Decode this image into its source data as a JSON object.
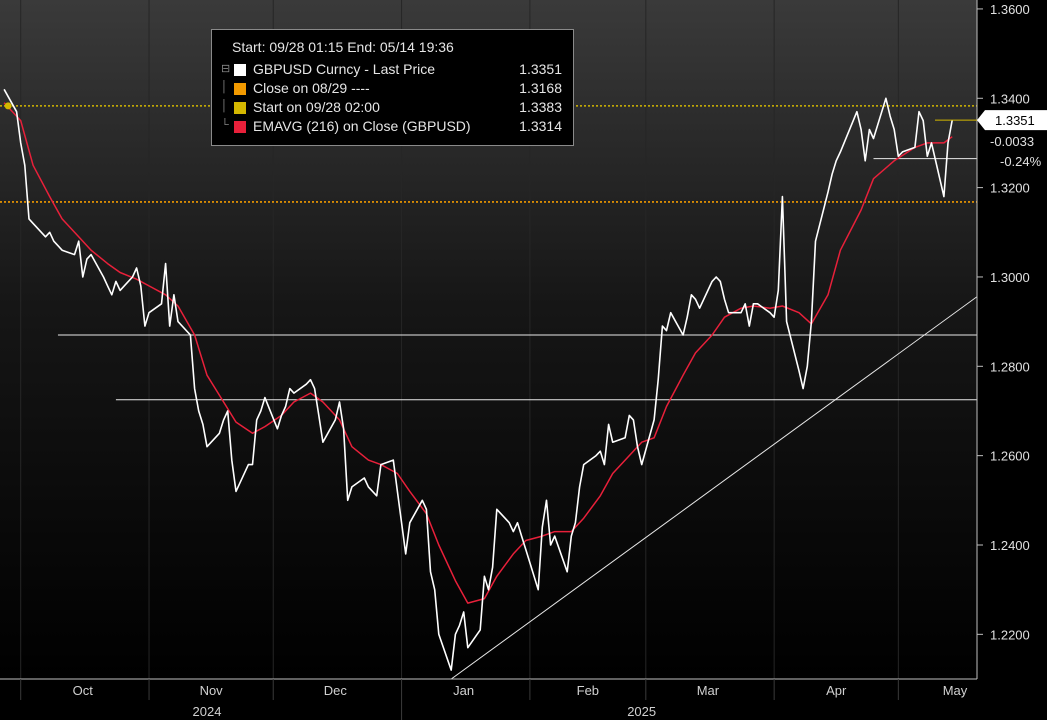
{
  "chart_data": {
    "type": "line",
    "title": "",
    "xlabel": "",
    "ylabel": "",
    "ylim": [
      1.2,
      1.36
    ],
    "yticks": [
      "1.2200",
      "1.2400",
      "1.2600",
      "1.2800",
      "1.3000",
      "1.3200",
      "1.3400",
      "1.3600"
    ],
    "months": [
      {
        "label": "Oct",
        "date": "2024-10-01"
      },
      {
        "label": "Nov",
        "date": "2024-11-01"
      },
      {
        "label": "Dec",
        "date": "2024-12-01"
      },
      {
        "label": "Jan",
        "date": "2025-01-01"
      },
      {
        "label": "Feb",
        "date": "2025-02-01"
      },
      {
        "label": "Mar",
        "date": "2025-03-01"
      },
      {
        "label": "Apr",
        "date": "2025-04-01"
      },
      {
        "label": "May",
        "date": "2025-05-01"
      }
    ],
    "years": [
      {
        "label": "2024",
        "date": "2024-11-15"
      },
      {
        "label": "2025",
        "date": "2025-02-28"
      }
    ],
    "legend": {
      "header": "Start: 09/28 01:15 End: 05/14 19:36",
      "entries": [
        {
          "label": "GBPUSD Curncy - Last Price",
          "value": "1.3351",
          "color": "#ffffff"
        },
        {
          "label": "Close on 08/29 ----",
          "value": "1.3168",
          "color": "#f29a00"
        },
        {
          "label": "Start on 09/28 02:00",
          "value": "1.3383",
          "color": "#d4b700"
        },
        {
          "label": "EMAVG (216)  on Close (GBPUSD)",
          "value": "1.3314",
          "color": "#e8203a"
        }
      ]
    },
    "price_tags": {
      "last": "1.3351",
      "change": "-0.0033",
      "change_pct": "-0.24%"
    },
    "reference_lines": [
      {
        "name": "close-0829",
        "y": 1.3168,
        "color": "#f29a00",
        "style": "dotted"
      },
      {
        "name": "start-0928",
        "y": 1.3383,
        "color": "#d4b700",
        "style": "dotted"
      }
    ],
    "support_lines": [
      {
        "y": 1.287,
        "from": "2024-10-10",
        "to": "2025-05-22"
      },
      {
        "y": 1.2725,
        "from": "2024-10-24",
        "to": "2025-05-22"
      },
      {
        "y": 1.3265,
        "from": "2025-04-25",
        "to": "2025-05-22"
      }
    ],
    "trendline": {
      "from": {
        "x": "2025-01-13",
        "y": 1.21
      },
      "to": {
        "x": "2025-05-27",
        "y": 1.3003
      }
    },
    "series": [
      {
        "name": "GBPUSD Curncy - Last Price",
        "color": "#ffffff",
        "points": [
          [
            "2024-09-27",
            1.342
          ],
          [
            "2024-09-30",
            1.337
          ],
          [
            "2024-10-01",
            1.33
          ],
          [
            "2024-10-02",
            1.325
          ],
          [
            "2024-10-03",
            1.313
          ],
          [
            "2024-10-04",
            1.312
          ],
          [
            "2024-10-07",
            1.309
          ],
          [
            "2024-10-08",
            1.31
          ],
          [
            "2024-10-09",
            1.308
          ],
          [
            "2024-10-10",
            1.307
          ],
          [
            "2024-10-11",
            1.306
          ],
          [
            "2024-10-14",
            1.305
          ],
          [
            "2024-10-15",
            1.308
          ],
          [
            "2024-10-16",
            1.3
          ],
          [
            "2024-10-17",
            1.304
          ],
          [
            "2024-10-18",
            1.305
          ],
          [
            "2024-10-21",
            1.3
          ],
          [
            "2024-10-22",
            1.298
          ],
          [
            "2024-10-23",
            1.296
          ],
          [
            "2024-10-24",
            1.299
          ],
          [
            "2024-10-25",
            1.297
          ],
          [
            "2024-10-28",
            1.3
          ],
          [
            "2024-10-29",
            1.302
          ],
          [
            "2024-10-30",
            1.298
          ],
          [
            "2024-10-31",
            1.289
          ],
          [
            "2024-11-01",
            1.292
          ],
          [
            "2024-11-04",
            1.294
          ],
          [
            "2024-11-05",
            1.303
          ],
          [
            "2024-11-06",
            1.289
          ],
          [
            "2024-11-07",
            1.296
          ],
          [
            "2024-11-08",
            1.29
          ],
          [
            "2024-11-11",
            1.287
          ],
          [
            "2024-11-12",
            1.275
          ],
          [
            "2024-11-13",
            1.27
          ],
          [
            "2024-11-14",
            1.267
          ],
          [
            "2024-11-15",
            1.262
          ],
          [
            "2024-11-18",
            1.265
          ],
          [
            "2024-11-19",
            1.268
          ],
          [
            "2024-11-20",
            1.27
          ],
          [
            "2024-11-21",
            1.259
          ],
          [
            "2024-11-22",
            1.252
          ],
          [
            "2024-11-25",
            1.258
          ],
          [
            "2024-11-26",
            1.258
          ],
          [
            "2024-11-27",
            1.268
          ],
          [
            "2024-11-28",
            1.27
          ],
          [
            "2024-11-29",
            1.273
          ],
          [
            "2024-12-02",
            1.266
          ],
          [
            "2024-12-03",
            1.269
          ],
          [
            "2024-12-04",
            1.271
          ],
          [
            "2024-12-05",
            1.275
          ],
          [
            "2024-12-06",
            1.274
          ],
          [
            "2024-12-09",
            1.276
          ],
          [
            "2024-12-10",
            1.277
          ],
          [
            "2024-12-11",
            1.275
          ],
          [
            "2024-12-12",
            1.269
          ],
          [
            "2024-12-13",
            1.263
          ],
          [
            "2024-12-16",
            1.268
          ],
          [
            "2024-12-17",
            1.272
          ],
          [
            "2024-12-18",
            1.266
          ],
          [
            "2024-12-19",
            1.25
          ],
          [
            "2024-12-20",
            1.253
          ],
          [
            "2024-12-23",
            1.255
          ],
          [
            "2024-12-24",
            1.253
          ],
          [
            "2024-12-26",
            1.251
          ],
          [
            "2024-12-27",
            1.258
          ],
          [
            "2024-12-30",
            1.259
          ],
          [
            "2024-12-31",
            1.252
          ],
          [
            "2025-01-02",
            1.238
          ],
          [
            "2025-01-03",
            1.245
          ],
          [
            "2025-01-06",
            1.25
          ],
          [
            "2025-01-07",
            1.248
          ],
          [
            "2025-01-08",
            1.234
          ],
          [
            "2025-01-09",
            1.23
          ],
          [
            "2025-01-10",
            1.22
          ],
          [
            "2025-01-13",
            1.212
          ],
          [
            "2025-01-14",
            1.22
          ],
          [
            "2025-01-15",
            1.222
          ],
          [
            "2025-01-16",
            1.225
          ],
          [
            "2025-01-17",
            1.217
          ],
          [
            "2025-01-20",
            1.221
          ],
          [
            "2025-01-21",
            1.233
          ],
          [
            "2025-01-22",
            1.23
          ],
          [
            "2025-01-23",
            1.235
          ],
          [
            "2025-01-24",
            1.248
          ],
          [
            "2025-01-27",
            1.245
          ],
          [
            "2025-01-28",
            1.243
          ],
          [
            "2025-01-29",
            1.245
          ],
          [
            "2025-01-30",
            1.242
          ],
          [
            "2025-01-31",
            1.239
          ],
          [
            "2025-02-03",
            1.23
          ],
          [
            "2025-02-04",
            1.244
          ],
          [
            "2025-02-05",
            1.25
          ],
          [
            "2025-02-06",
            1.24
          ],
          [
            "2025-02-07",
            1.242
          ],
          [
            "2025-02-10",
            1.234
          ],
          [
            "2025-02-11",
            1.242
          ],
          [
            "2025-02-12",
            1.245
          ],
          [
            "2025-02-13",
            1.253
          ],
          [
            "2025-02-14",
            1.258
          ],
          [
            "2025-02-17",
            1.26
          ],
          [
            "2025-02-18",
            1.261
          ],
          [
            "2025-02-19",
            1.258
          ],
          [
            "2025-02-20",
            1.267
          ],
          [
            "2025-02-21",
            1.263
          ],
          [
            "2025-02-24",
            1.264
          ],
          [
            "2025-02-25",
            1.269
          ],
          [
            "2025-02-26",
            1.268
          ],
          [
            "2025-02-27",
            1.262
          ],
          [
            "2025-02-28",
            1.258
          ],
          [
            "2025-03-03",
            1.268
          ],
          [
            "2025-03-04",
            1.277
          ],
          [
            "2025-03-05",
            1.289
          ],
          [
            "2025-03-06",
            1.288
          ],
          [
            "2025-03-07",
            1.292
          ],
          [
            "2025-03-10",
            1.287
          ],
          [
            "2025-03-11",
            1.291
          ],
          [
            "2025-03-12",
            1.296
          ],
          [
            "2025-03-13",
            1.295
          ],
          [
            "2025-03-14",
            1.293
          ],
          [
            "2025-03-17",
            1.299
          ],
          [
            "2025-03-18",
            1.3
          ],
          [
            "2025-03-19",
            1.299
          ],
          [
            "2025-03-20",
            1.295
          ],
          [
            "2025-03-21",
            1.292
          ],
          [
            "2025-03-24",
            1.292
          ],
          [
            "2025-03-25",
            1.294
          ],
          [
            "2025-03-26",
            1.289
          ],
          [
            "2025-03-27",
            1.294
          ],
          [
            "2025-03-28",
            1.294
          ],
          [
            "2025-03-31",
            1.292
          ],
          [
            "2025-04-01",
            1.291
          ],
          [
            "2025-04-02",
            1.297
          ],
          [
            "2025-04-03",
            1.318
          ],
          [
            "2025-04-04",
            1.29
          ],
          [
            "2025-04-07",
            1.279
          ],
          [
            "2025-04-08",
            1.275
          ],
          [
            "2025-04-09",
            1.28
          ],
          [
            "2025-04-10",
            1.29
          ],
          [
            "2025-04-11",
            1.308
          ],
          [
            "2025-04-14",
            1.319
          ],
          [
            "2025-04-15",
            1.323
          ],
          [
            "2025-04-16",
            1.326
          ],
          [
            "2025-04-17",
            1.328
          ],
          [
            "2025-04-21",
            1.337
          ],
          [
            "2025-04-22",
            1.333
          ],
          [
            "2025-04-23",
            1.326
          ],
          [
            "2025-04-24",
            1.333
          ],
          [
            "2025-04-25",
            1.331
          ],
          [
            "2025-04-28",
            1.34
          ],
          [
            "2025-04-29",
            1.336
          ],
          [
            "2025-04-30",
            1.333
          ],
          [
            "2025-05-01",
            1.327
          ],
          [
            "2025-05-02",
            1.328
          ],
          [
            "2025-05-05",
            1.329
          ],
          [
            "2025-05-06",
            1.337
          ],
          [
            "2025-05-07",
            1.335
          ],
          [
            "2025-05-08",
            1.327
          ],
          [
            "2025-05-09",
            1.33
          ],
          [
            "2025-05-12",
            1.318
          ],
          [
            "2025-05-13",
            1.33
          ],
          [
            "2025-05-14",
            1.3351
          ]
        ]
      },
      {
        "name": "EMAVG (216)  on Close (GBPUSD)",
        "color": "#e8203a",
        "points": [
          [
            "2024-09-27",
            1.339
          ],
          [
            "2024-10-01",
            1.335
          ],
          [
            "2024-10-04",
            1.325
          ],
          [
            "2024-10-08",
            1.318
          ],
          [
            "2024-10-11",
            1.313
          ],
          [
            "2024-10-15",
            1.309
          ],
          [
            "2024-10-18",
            1.306
          ],
          [
            "2024-10-22",
            1.303
          ],
          [
            "2024-10-25",
            1.301
          ],
          [
            "2024-10-29",
            1.2995
          ],
          [
            "2024-11-01",
            1.298
          ],
          [
            "2024-11-05",
            1.296
          ],
          [
            "2024-11-08",
            1.2935
          ],
          [
            "2024-11-12",
            1.287
          ],
          [
            "2024-11-15",
            1.278
          ],
          [
            "2024-11-19",
            1.272
          ],
          [
            "2024-11-22",
            1.2675
          ],
          [
            "2024-11-26",
            1.265
          ],
          [
            "2024-11-29",
            1.2665
          ],
          [
            "2024-12-03",
            1.269
          ],
          [
            "2024-12-06",
            1.272
          ],
          [
            "2024-12-10",
            1.274
          ],
          [
            "2024-12-13",
            1.272
          ],
          [
            "2024-12-17",
            1.268
          ],
          [
            "2024-12-20",
            1.262
          ],
          [
            "2024-12-24",
            1.259
          ],
          [
            "2024-12-27",
            1.258
          ],
          [
            "2024-12-31",
            1.256
          ],
          [
            "2025-01-03",
            1.252
          ],
          [
            "2025-01-07",
            1.247
          ],
          [
            "2025-01-10",
            1.24
          ],
          [
            "2025-01-14",
            1.232
          ],
          [
            "2025-01-17",
            1.227
          ],
          [
            "2025-01-21",
            1.228
          ],
          [
            "2025-01-24",
            1.233
          ],
          [
            "2025-01-28",
            1.238
          ],
          [
            "2025-01-31",
            1.241
          ],
          [
            "2025-02-04",
            1.242
          ],
          [
            "2025-02-07",
            1.243
          ],
          [
            "2025-02-11",
            1.243
          ],
          [
            "2025-02-14",
            1.246
          ],
          [
            "2025-02-18",
            1.251
          ],
          [
            "2025-02-21",
            1.256
          ],
          [
            "2025-02-25",
            1.26
          ],
          [
            "2025-02-28",
            1.263
          ],
          [
            "2025-03-03",
            1.264
          ],
          [
            "2025-03-06",
            1.271
          ],
          [
            "2025-03-10",
            1.278
          ],
          [
            "2025-03-13",
            1.283
          ],
          [
            "2025-03-17",
            1.287
          ],
          [
            "2025-03-20",
            1.291
          ],
          [
            "2025-03-24",
            1.293
          ],
          [
            "2025-03-27",
            1.2935
          ],
          [
            "2025-03-31",
            1.293
          ],
          [
            "2025-04-03",
            1.2935
          ],
          [
            "2025-04-07",
            1.292
          ],
          [
            "2025-04-10",
            1.2895
          ],
          [
            "2025-04-14",
            1.296
          ],
          [
            "2025-04-17",
            1.306
          ],
          [
            "2025-04-22",
            1.315
          ],
          [
            "2025-04-25",
            1.322
          ],
          [
            "2025-04-30",
            1.326
          ],
          [
            "2025-05-05",
            1.329
          ],
          [
            "2025-05-08",
            1.33
          ],
          [
            "2025-05-12",
            1.33
          ],
          [
            "2025-05-14",
            1.3314
          ]
        ]
      }
    ]
  }
}
